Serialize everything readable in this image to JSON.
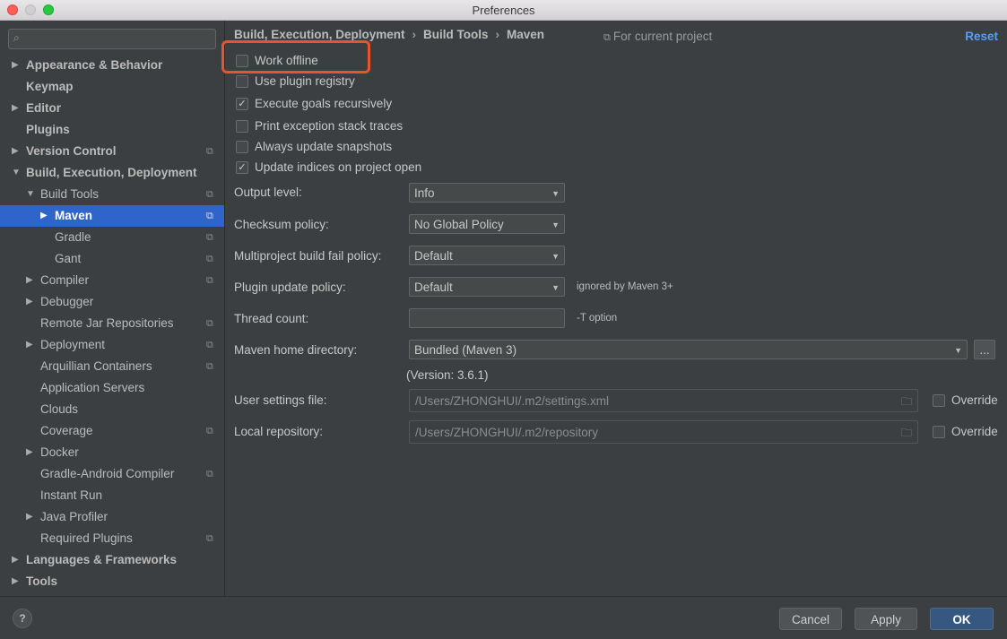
{
  "window": {
    "title": "Preferences"
  },
  "sidebar": {
    "search_placeholder": "",
    "items": [
      {
        "label": "Appearance & Behavior",
        "bold": true
      },
      {
        "label": "Keymap",
        "bold": true
      },
      {
        "label": "Editor",
        "bold": true
      },
      {
        "label": "Plugins",
        "bold": true
      },
      {
        "label": "Version Control",
        "bold": true
      },
      {
        "label": "Build, Execution, Deployment",
        "bold": true
      },
      {
        "label": "Build Tools",
        "bold": false
      },
      {
        "label": "Maven",
        "bold": false,
        "selected": true
      },
      {
        "label": "Gradle",
        "bold": false
      },
      {
        "label": "Gant",
        "bold": false
      },
      {
        "label": "Compiler",
        "bold": false
      },
      {
        "label": "Debugger",
        "bold": false
      },
      {
        "label": "Remote Jar Repositories",
        "bold": false
      },
      {
        "label": "Deployment",
        "bold": false
      },
      {
        "label": "Arquillian Containers",
        "bold": false
      },
      {
        "label": "Application Servers",
        "bold": false
      },
      {
        "label": "Clouds",
        "bold": false
      },
      {
        "label": "Coverage",
        "bold": false
      },
      {
        "label": "Docker",
        "bold": false
      },
      {
        "label": "Gradle-Android Compiler",
        "bold": false
      },
      {
        "label": "Instant Run",
        "bold": false
      },
      {
        "label": "Java Profiler",
        "bold": false
      },
      {
        "label": "Required Plugins",
        "bold": false
      },
      {
        "label": "Languages & Frameworks",
        "bold": true
      },
      {
        "label": "Tools",
        "bold": true
      }
    ]
  },
  "header": {
    "breadcrumb": [
      "Build, Execution, Deployment",
      "Build Tools",
      "Maven"
    ],
    "project_scope": "For current project",
    "reset": "Reset"
  },
  "checkboxes": [
    {
      "label": "Work offline",
      "checked": false
    },
    {
      "label": "Use plugin registry",
      "checked": false
    },
    {
      "label": "Execute goals recursively",
      "checked": true
    },
    {
      "label": "Print exception stack traces",
      "checked": false
    },
    {
      "label": "Always update snapshots",
      "checked": false
    },
    {
      "label": "Update indices on project open",
      "checked": true
    }
  ],
  "form": {
    "output_level": {
      "label": "Output level:",
      "value": "Info"
    },
    "checksum_policy": {
      "label": "Checksum policy:",
      "value": "No Global Policy"
    },
    "multiproject_policy": {
      "label": "Multiproject build fail policy:",
      "value": "Default"
    },
    "plugin_update_policy": {
      "label": "Plugin update policy:",
      "value": "Default",
      "hint": "ignored by Maven 3+"
    },
    "thread_count": {
      "label": "Thread count:",
      "value": "",
      "hint": "-T option"
    },
    "maven_home": {
      "label": "Maven home directory:",
      "value": "Bundled (Maven 3)",
      "browse": "...",
      "version": "(Version: 3.6.1)"
    },
    "user_settings": {
      "label": "User settings file:",
      "value": "/Users/ZHONGHUI/.m2/settings.xml",
      "override": "Override"
    },
    "local_repository": {
      "label": "Local repository:",
      "value": "/Users/ZHONGHUI/.m2/repository",
      "override": "Override"
    }
  },
  "footer": {
    "help": "?",
    "cancel": "Cancel",
    "apply": "Apply",
    "ok": "OK"
  },
  "colors": {
    "accent": "#2f65ca",
    "highlight": "#e8542b",
    "link": "#589df6"
  }
}
